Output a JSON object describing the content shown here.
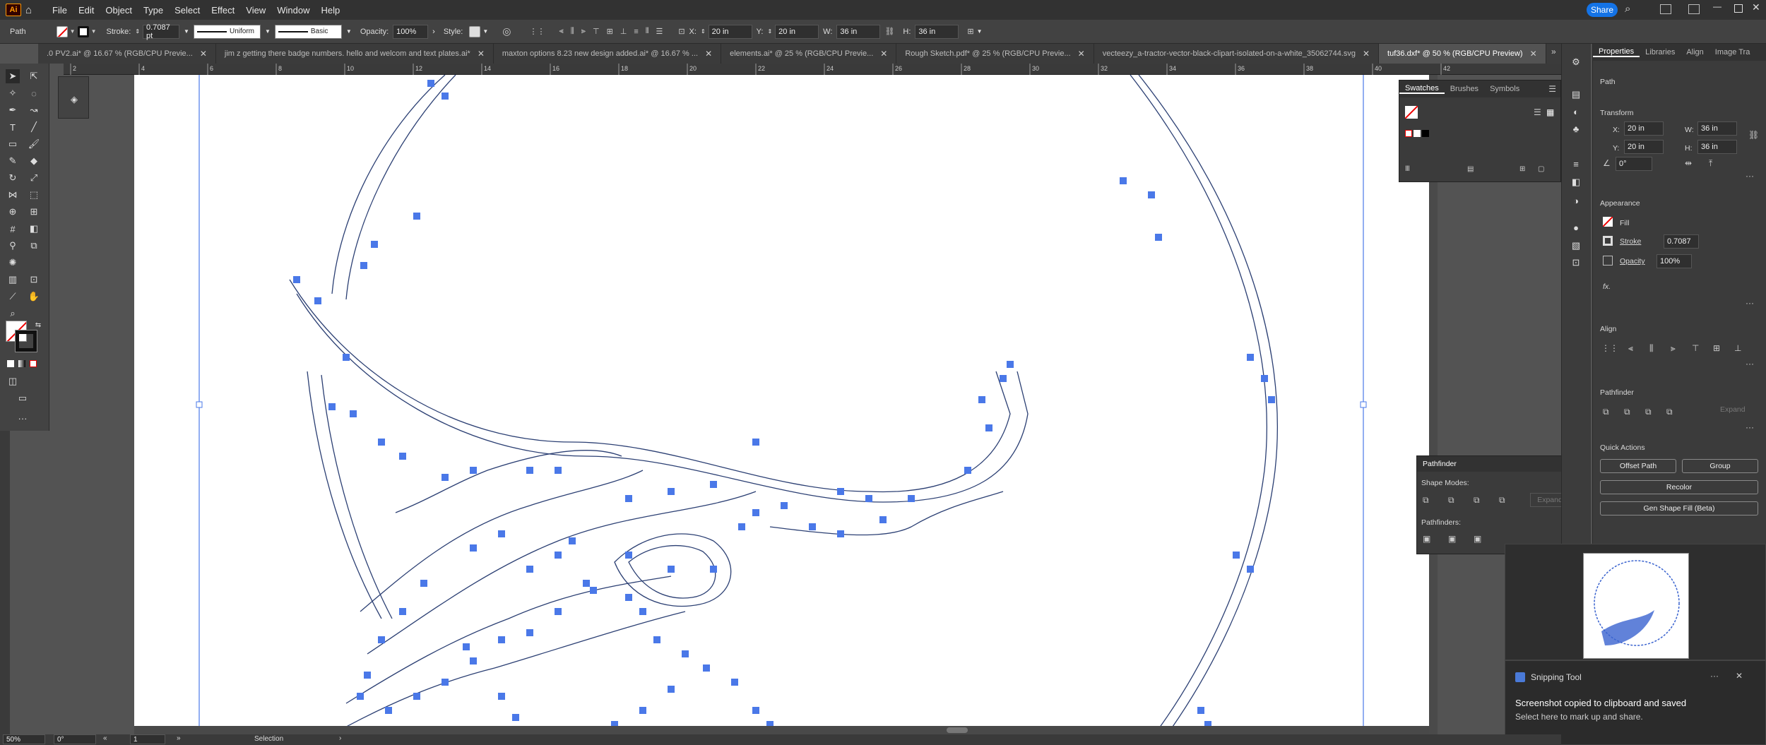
{
  "app": {
    "logo_text": "Ai",
    "share_label": "Share"
  },
  "menu": [
    "File",
    "Edit",
    "Object",
    "Type",
    "Select",
    "Effect",
    "View",
    "Window",
    "Help"
  ],
  "control_bar": {
    "selection_type": "Path",
    "stroke_label": "Stroke:",
    "stroke_value": "0.7087 pt",
    "profile_label": "Uniform",
    "brush_label": "Basic",
    "opacity_label": "Opacity:",
    "opacity_value": "100%",
    "style_label": "Style:",
    "x_label": "X:",
    "x_value": "20 in",
    "y_label": "Y:",
    "y_value": "20 in",
    "w_label": "W:",
    "w_value": "36 in",
    "h_label": "H:",
    "h_value": "36 in"
  },
  "tabs": [
    {
      "label": ".0 PV2.ai* @ 16.67 % (RGB/CPU Previe...",
      "active": false
    },
    {
      "label": "jim z getting there badge numbers. hello and welcom and text plates.ai*",
      "active": false
    },
    {
      "label": "maxton options 8.23 new design added.ai* @ 16.67 % ...",
      "active": false
    },
    {
      "label": "elements.ai* @ 25 % (RGB/CPU Previe...",
      "active": false
    },
    {
      "label": "Rough Sketch.pdf* @ 25 % (RGB/CPU Previe...",
      "active": false
    },
    {
      "label": "vecteezy_a-tractor-vector-black-clipart-isolated-on-a-white_35062744.svg",
      "active": false
    },
    {
      "label": "tuf36.dxf* @ 50 % (RGB/CPU Preview)",
      "active": true
    }
  ],
  "ruler_top": [
    "2",
    "4",
    "6",
    "8",
    "10",
    "12",
    "14",
    "16",
    "18",
    "20",
    "22",
    "24",
    "26",
    "28",
    "30",
    "32",
    "34",
    "36",
    "38",
    "40",
    "42"
  ],
  "swatches": {
    "tabs": [
      "Swatches",
      "Brushes",
      "Symbols"
    ]
  },
  "pathfinder": {
    "title": "Pathfinder",
    "shape_modes": "Shape Modes:",
    "pathfinders": "Pathfinders:",
    "expand": "Expand"
  },
  "properties": {
    "tabs": [
      "Properties",
      "Libraries",
      "Align",
      "Image Tra"
    ],
    "selection": "Path",
    "transform": "Transform",
    "x_label": "X:",
    "x_value": "20 in",
    "y_label": "Y:",
    "y_value": "20 in",
    "w_label": "W:",
    "w_value": "36 in",
    "h_label": "H:",
    "h_value": "36 in",
    "angle_value": "0°",
    "appearance": "Appearance",
    "fill": "Fill",
    "stroke": "Stroke",
    "stroke_value": "0.7087",
    "opacity": "Opacity",
    "opacity_value": "100%",
    "fx": "fx.",
    "align": "Align",
    "pathfinder": "Pathfinder",
    "expand": "Expand",
    "quick_actions": "Quick Actions",
    "offset_path": "Offset Path",
    "group": "Group",
    "recolor": "Recolor",
    "gen_shape_fill": "Gen Shape Fill (Beta)"
  },
  "status_bar": {
    "zoom": "50%",
    "angle": "0°",
    "artboard": "1",
    "tool": "Selection"
  },
  "toast": {
    "app": "Snipping Tool",
    "title": "Screenshot copied to clipboard and saved",
    "body": "Select here to mark up and share.",
    "more": "···",
    "close": "✕"
  },
  "colors": {
    "anchor": "#4a78e8",
    "path": "#2b3f73",
    "accent": "#1473e6"
  }
}
